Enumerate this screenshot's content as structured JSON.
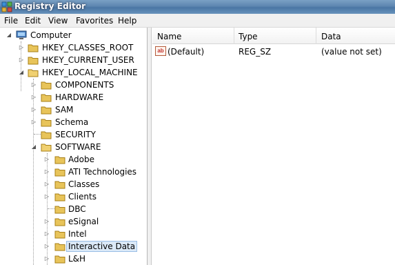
{
  "window": {
    "title": "Registry Editor"
  },
  "menu": [
    "File",
    "Edit",
    "View",
    "Favorites",
    "Help"
  ],
  "tree": {
    "root": "Computer",
    "nodes": [
      "HKEY_CLASSES_ROOT",
      "HKEY_CURRENT_USER",
      "HKEY_LOCAL_MACHINE",
      "COMPONENTS",
      "HARDWARE",
      "SAM",
      "Schema",
      "SECURITY",
      "SOFTWARE",
      "Adobe",
      "ATI Technologies",
      "Classes",
      "Clients",
      "DBC",
      "eSignal",
      "Intel",
      "Interactive Data",
      "L&H"
    ],
    "selected": "Interactive Data"
  },
  "list": {
    "columns": [
      "Name",
      "Type",
      "Data"
    ],
    "rows": [
      {
        "name": "(Default)",
        "type": "REG_SZ",
        "data": "(value not set)"
      }
    ]
  }
}
